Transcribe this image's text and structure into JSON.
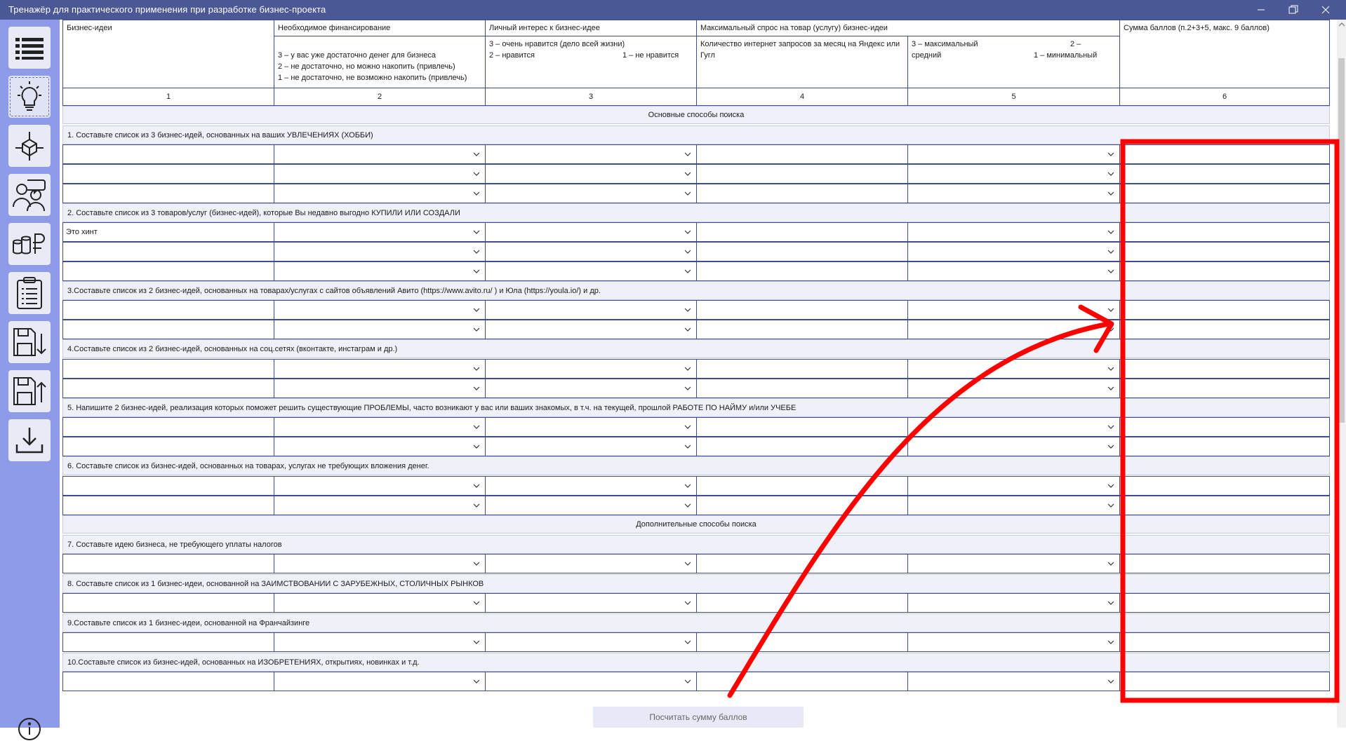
{
  "window": {
    "title": "Тренажёр для практического применения при разработке бизнес-проекта"
  },
  "sidebar": {
    "buttons": [
      {
        "icon": "list-icon"
      },
      {
        "icon": "lightbulb-icon"
      },
      {
        "icon": "cube-icon"
      },
      {
        "icon": "people-icon"
      },
      {
        "icon": "coins-ruble-icon"
      },
      {
        "icon": "clipboard-icon"
      },
      {
        "icon": "save-down-icon"
      },
      {
        "icon": "save-up-icon"
      },
      {
        "icon": "download-icon"
      }
    ],
    "info_icon": "info-icon"
  },
  "table": {
    "headers": {
      "c1": "Бизнес-идеи",
      "c2": "Необходимое финансирование",
      "c3": "Личный интерес к бизнес-идее",
      "c45": "Максимальный спрос на товар (услугу) бизнес-идеи",
      "c6": "Сумма баллов (п.2+3+5, макс. 9 баллов)",
      "c2_sub": "3 – у вас уже достаточно денег для бизнеса\n2 – не достаточно, но можно накопить (привлечь)\n1 – не достаточно, не возможно накопить (привлечь)",
      "c3_sub_a": "3 – очень нравится (дело всей жизни)",
      "c3_sub_b": "2 – нравится",
      "c3_sub_c": "1 – не нравится",
      "c4_sub": "Количество интернет запросов за месяц на Яндекс или Гугл",
      "c5_sub_a": "3 – максимальный",
      "c5_sub_b": "2 –",
      "c5_sub_c": "средний",
      "c5_sub_d": "1 – минимальный"
    },
    "numbers": [
      "1",
      "2",
      "3",
      "4",
      "5",
      "6"
    ],
    "sections": {
      "main": "Основные способы поиска",
      "extra": "Дополнительные способы поиска"
    },
    "questions": [
      "1. Составьте список из 3 бизнес-идей, основанных на ваших УВЛЕЧЕНИЯХ (ХОББИ)",
      "2. Составьте список из 3 товаров/услуг (бизнес-идей), которые Вы недавно выгодно КУПИЛИ ИЛИ СОЗДАЛИ",
      "3.Составьте список из 2 бизнес-идей, основанных на товарах/услугах с сайтов объявлений Авито (https://www.avito.ru/ ) и Юла (https://youla.io/) и др.",
      "4.Составьте список из 2 бизнес-идей, основанных на соц.сетях (вконтакте, инстаграм и др.)",
      "5. Напишите 2 бизнес-идей, реализация которых поможет решить существующие ПРОБЛЕМЫ, часто возникают у вас или ваших знакомых, в т.ч. на текущей, прошлой РАБОТЕ ПО НАЙМУ и/или УЧЕБЕ",
      "6. Составьте список из бизнес-идей, основанных на товарах, услугах не требующих вложения денег.",
      "7. Составьте идею бизнеса, не требующего уплаты налогов",
      "8. Составьте список из 1 бизнес-идеи, основанной на ЗАИМСТВОВАНИИ С ЗАРУБЕЖНЫХ, СТОЛИЧНЫХ РЫНКОВ",
      "9.Составьте список из 1 бизнес-идеи, основанной на Франчайзинге",
      "10.Составьте список из бизнес-идей, основанных на ИЗОБРЕТЕНИЯХ, открытиях, новинках и т.д."
    ],
    "hint_text": "Это хинт"
  },
  "calc_button": {
    "label": "Посчитать сумму баллов"
  },
  "annotation": {
    "color": "#ff0000"
  }
}
